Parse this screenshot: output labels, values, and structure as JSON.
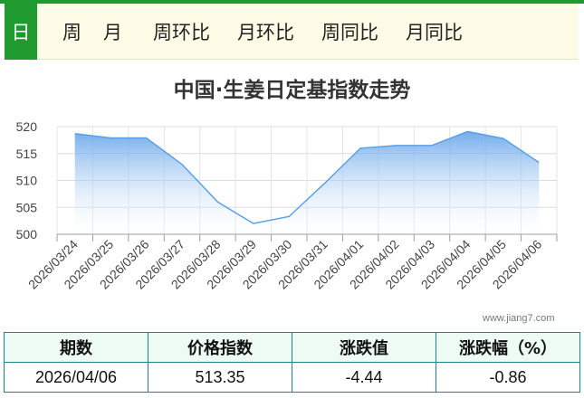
{
  "tabs": [
    {
      "label": "日",
      "active": true
    },
    {
      "label": "周",
      "active": false
    },
    {
      "label": "月",
      "active": false
    },
    {
      "label": "周环比",
      "active": false
    },
    {
      "label": "月环比",
      "active": false
    },
    {
      "label": "周同比",
      "active": false
    },
    {
      "label": "月同比",
      "active": false
    }
  ],
  "watermark": "www.jiang7.com",
  "colors": {
    "accent": "#1f9a2f",
    "line": "#5aa0e6",
    "area_top": "#5b9ee8",
    "area_bottom": "#ffffff",
    "table_border": "#1b8a86"
  },
  "chart_data": {
    "type": "area",
    "title": "中国·生姜日定基指数走势",
    "categories": [
      "2026/03/24",
      "2026/03/25",
      "2026/03/26",
      "2026/03/27",
      "2026/03/28",
      "2026/03/29",
      "2026/03/30",
      "2026/03/31",
      "2026/04/01",
      "2026/04/02",
      "2026/04/03",
      "2026/04/04",
      "2026/04/05",
      "2026/04/06"
    ],
    "values": [
      518.7,
      517.9,
      517.9,
      513.0,
      506.0,
      502.0,
      503.3,
      509.5,
      516.0,
      516.5,
      516.5,
      519.1,
      517.8,
      513.35
    ],
    "ylim": [
      500,
      520
    ],
    "yticks": [
      500,
      505,
      510,
      515,
      520
    ],
    "grid": true,
    "legend": "none"
  },
  "table": {
    "headers": [
      "期数",
      "价格指数",
      "涨跌值",
      "涨跌幅（%）"
    ],
    "row": [
      "2026/04/06",
      "513.35",
      "-4.44",
      "-0.86"
    ]
  }
}
